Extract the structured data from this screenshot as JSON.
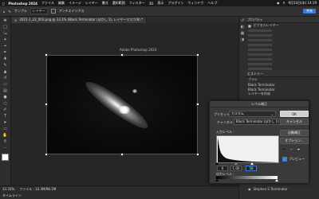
{
  "menubar": {
    "app": "Photoshop 2024",
    "items": [
      "ファイル",
      "編集",
      "イメージ",
      "レイヤー",
      "書式",
      "選択範囲",
      "フィルター",
      "3D",
      "表示",
      "プラグイン",
      "ウィンドウ",
      "ヘルプ"
    ],
    "clock": "9月14日(木) 14:19"
  },
  "optionsbar": {
    "sample_label": "サンプル",
    "sample_value": "レイヤー",
    "allow_label": "アンチエイリアス",
    "share_label": "共有"
  },
  "document": {
    "tab_label": "2021-1_22_003.png @ 33.3% (Black Terminator (ぼかし 1), レイヤーマスク/8) *",
    "window_title": "Adobe Photoshop 2024",
    "zoom": "33.33%",
    "doc_info": "ファイル : 33.3M/98.1M"
  },
  "statusbar": {
    "bottom_label": "タイムライン"
  },
  "panels": {
    "properties_title": "プロパティ",
    "properties_sub": "ピクセルレイヤー",
    "history_title": "ヒストリー",
    "history_items": [
      "ブラシ",
      "Black Terminator",
      "Black Terminator",
      "レイヤーを作成"
    ],
    "layer_name": "Stephen S Terminator"
  },
  "levels_dialog": {
    "title": "レベル補正",
    "preset_label": "プリセット :",
    "preset_value": "カスタム",
    "channel_label": "チャンネル :",
    "channel_value": "Black Terminator (ぼかし 1) マスク",
    "input_label": "入力レベル :",
    "output_label": "出力レベル :",
    "input_black": "0",
    "input_gamma": "1.00",
    "input_white": "58",
    "output_black": "0",
    "output_white": "255",
    "ok": "OK",
    "cancel": "キャンセル",
    "auto": "自動補正",
    "options": "オプション...",
    "preview": "プレビュー"
  },
  "colors": {
    "accent": "#3b7bd9",
    "panel_bg": "#2e2e2e",
    "dialog_bg": "#3a3a3a"
  }
}
